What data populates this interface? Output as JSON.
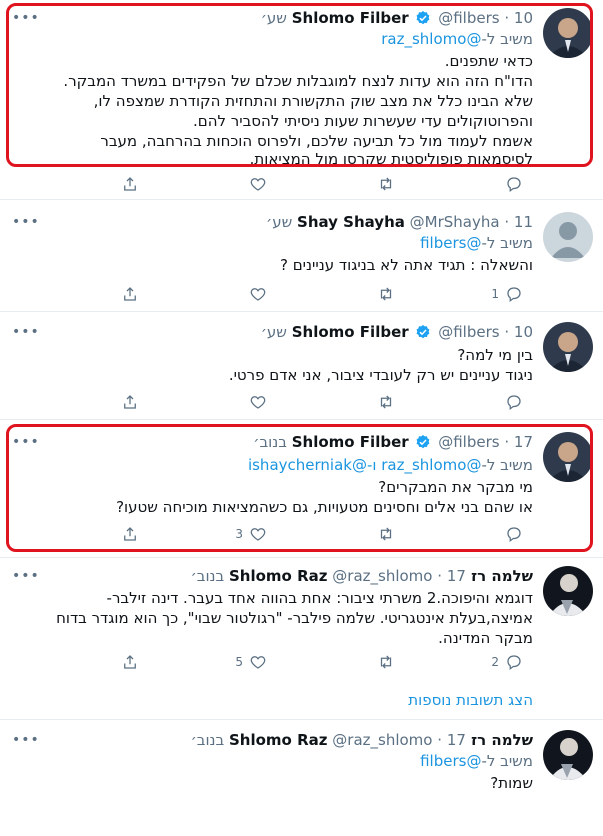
{
  "colors": {
    "accent": "#1b95e0",
    "muted": "#5b7083",
    "highlight": "#e0141e",
    "verified": "#1da1f2"
  },
  "tweets": [
    {
      "name": "Shlomo Filber",
      "handle": "@filbers",
      "time": "10 שע׳",
      "verified": true,
      "reply_label": "משיב ל-",
      "reply_mentions": "@raz_shlomo",
      "lines": [
        "כדאי שתפנים.",
        "הדו\"ח הזה הוא עדות לנצח למוגבלות שכלם של הפקידים במשרד המבקר.",
        "שלא הבינו כלל את מצב שוק התקשורת והתחזית הקודרת שמצפה לו,",
        "והפרוטוקולים עדי שעשרות שעות ניסיתי להסביר להם.",
        "אשמח לעמוד מול כל תביעה שלכם, ולפרוס הוכחות בהרחבה, מעבר",
        "לסיסמאות פופוליסטית שקרסו מול המציאות."
      ],
      "counts": {
        "reply": "",
        "retweet": "",
        "like": ""
      }
    },
    {
      "name": "Shay Shayha",
      "handle": "@MrShayha",
      "time": "11 שע׳",
      "verified": false,
      "reply_label": "משיב ל-",
      "reply_mentions": "@filbers",
      "lines": [
        "והשאלה : תגיד אתה לא בניגוד עניינים ?"
      ],
      "counts": {
        "reply": "1",
        "retweet": "",
        "like": ""
      }
    },
    {
      "name": "Shlomo Filber",
      "handle": "@filbers",
      "time": "10 שע׳",
      "verified": true,
      "lines": [
        "בין מי למה?",
        "ניגוד עניינים יש רק לעובדי ציבור, אני אדם פרטי."
      ],
      "counts": {
        "reply": "",
        "retweet": "",
        "like": ""
      }
    },
    {
      "name": "Shlomo Filber",
      "handle": "@filbers",
      "time": "17 בנוב׳",
      "verified": true,
      "reply_label": "משיב ל-",
      "reply_mentions": "@raz_shlomo ו-@ishaycherniak",
      "lines": [
        "מי מבקר את המבקרים?",
        "או שהם בני אלים וחסינים מטעויות, גם כשהמציאות מוכיחה שטעו?"
      ],
      "counts": {
        "reply": "",
        "retweet": "",
        "like": "3"
      }
    },
    {
      "name": "שלמה רז Shlomo Raz",
      "handle": "@raz_shlomo",
      "time": "17 בנוב׳",
      "verified": false,
      "lines": [
        "דוגמא והיפוכה.2 משרתי ציבור: אחת בהווה אחד בעבר. דינה זילבר-",
        "אמיצה,בעלת אינטגריטי. שלמה פילבר- \"רגולטור שבוי\", כך הוא מוגדר בדוח",
        "מבקר המדינה."
      ],
      "counts": {
        "reply": "2",
        "retweet": "",
        "like": "5"
      }
    },
    {
      "name": "שלמה רז Shlomo Raz",
      "handle": "@raz_shlomo",
      "time": "17 בנוב׳",
      "verified": false,
      "reply_label": "משיב ל-",
      "reply_mentions": "@filbers",
      "lines": [
        "שמות?"
      ],
      "counts": {
        "reply": "",
        "retweet": "",
        "like": ""
      }
    }
  ],
  "show_more": "הצג תשובות נוספות",
  "more_glyph": "•••",
  "icons": [
    "reply-icon",
    "retweet-icon",
    "like-icon",
    "share-icon",
    "verified-icon",
    "more-icon"
  ]
}
